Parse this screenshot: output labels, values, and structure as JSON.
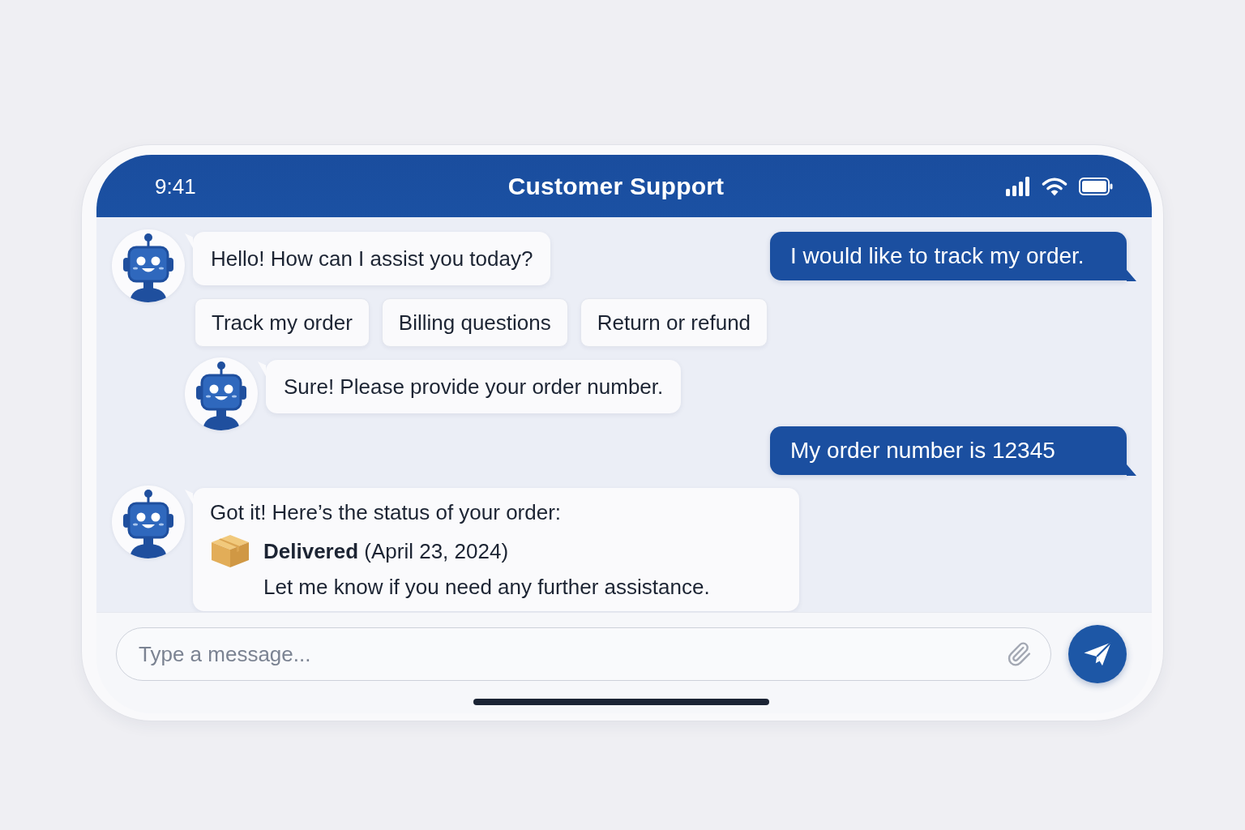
{
  "status_bar": {
    "time": "9:41"
  },
  "header": {
    "title": "Customer Support"
  },
  "chat_rows": [
    [
      {
        "kind": "bot",
        "text": "Hello! How can I assist you today?"
      },
      {
        "kind": "user",
        "text": "I would like to track my order."
      }
    ],
    [
      {
        "kind": "quick_replies",
        "options": [
          "Track my order",
          "Billing questions",
          "Return or refund"
        ]
      }
    ],
    [
      {
        "kind": "bot",
        "text": "Sure! Please provide your order number."
      }
    ],
    [
      {
        "kind": "user",
        "text": "My order number is 12345"
      }
    ],
    [
      {
        "kind": "bot_status",
        "text": "Got it! Here’s the status of your order:",
        "status": "**Delivered** (April 23, 2024)",
        "note": "Let me know if you need any further assistance."
      }
    ]
  ],
  "composer": {
    "placeholder": "Type a message..."
  }
}
